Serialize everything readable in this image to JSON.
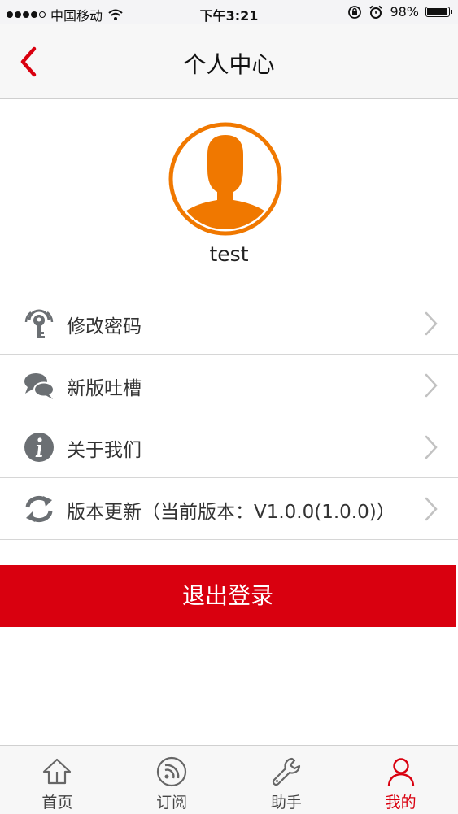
{
  "status_bar": {
    "carrier": "中国移动",
    "time": "下午3:21",
    "battery_text": "98%",
    "battery_level": 0.98
  },
  "header": {
    "title": "个人中心",
    "back_icon": "chevron-left-icon"
  },
  "profile": {
    "username": "test",
    "avatar_color": "#f07800"
  },
  "menu": {
    "items": [
      {
        "label": "修改密码",
        "icon": "key-icon"
      },
      {
        "label": "新版吐槽",
        "icon": "chat-bubbles-icon"
      },
      {
        "label": "关于我们",
        "icon": "info-icon"
      },
      {
        "label": "版本更新（当前版本：V1.0.0(1.0.0)）",
        "icon": "refresh-icon"
      }
    ]
  },
  "logout": {
    "label": "退出登录",
    "color": "#d9000f"
  },
  "tab_bar": {
    "active_color": "#d9000f",
    "tabs": [
      {
        "label": "首页",
        "icon": "home-icon"
      },
      {
        "label": "订阅",
        "icon": "rss-icon"
      },
      {
        "label": "助手",
        "icon": "wrench-icon"
      },
      {
        "label": "我的",
        "icon": "user-icon",
        "active": true
      }
    ]
  }
}
